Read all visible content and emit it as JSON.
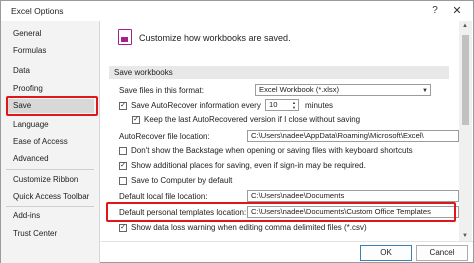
{
  "window": {
    "title": "Excel Options",
    "help_glyph": "?",
    "close_glyph": "✕"
  },
  "sidebar": {
    "items": [
      {
        "label": "General"
      },
      {
        "label": "Formulas"
      },
      {
        "label": "Data"
      },
      {
        "label": "Proofing"
      },
      {
        "label": "Save",
        "selected": true
      },
      {
        "label": "Language"
      },
      {
        "label": "Ease of Access"
      },
      {
        "label": "Advanced"
      },
      {
        "label": "Customize Ribbon"
      },
      {
        "label": "Quick Access Toolbar"
      },
      {
        "label": "Add-ins"
      },
      {
        "label": "Trust Center"
      }
    ]
  },
  "main": {
    "header": "Customize how workbooks are saved.",
    "section_title": "Save workbooks",
    "save_format_label": "Save files in this format:",
    "save_format_value": "Excel Workbook (*.xlsx)",
    "autorecover_label": "Save AutoRecover information every",
    "autorecover_minutes": "10",
    "minutes_label": "minutes",
    "keep_last_label": "Keep the last AutoRecovered version if I close without saving",
    "autorecover_location_label": "AutoRecover file location:",
    "autorecover_location_value": "C:\\Users\\nadee\\AppData\\Roaming\\Microsoft\\Excel\\",
    "dont_show_backstage_label": "Don't show the Backstage when opening or saving files with keyboard shortcuts",
    "show_additional_places_label": "Show additional places for saving, even if sign-in may be required.",
    "save_to_computer_label": "Save to Computer by default",
    "default_local_label": "Default local file location:",
    "default_local_value": "C:\\Users\\nadee\\Documents",
    "default_templates_label": "Default personal templates location:",
    "default_templates_value": "C:\\Users\\nadee\\Documents\\Custom Office Templates",
    "show_data_loss_label": "Show data loss warning when editing comma delimited files (*.csv)"
  },
  "buttons": {
    "ok": "OK",
    "cancel": "Cancel"
  },
  "colors": {
    "highlight": "#e0161b",
    "accent": "#a3228a"
  },
  "icons": {
    "check": "✓",
    "caret": "▼",
    "spin_up": "▲",
    "spin_down": "▼"
  }
}
